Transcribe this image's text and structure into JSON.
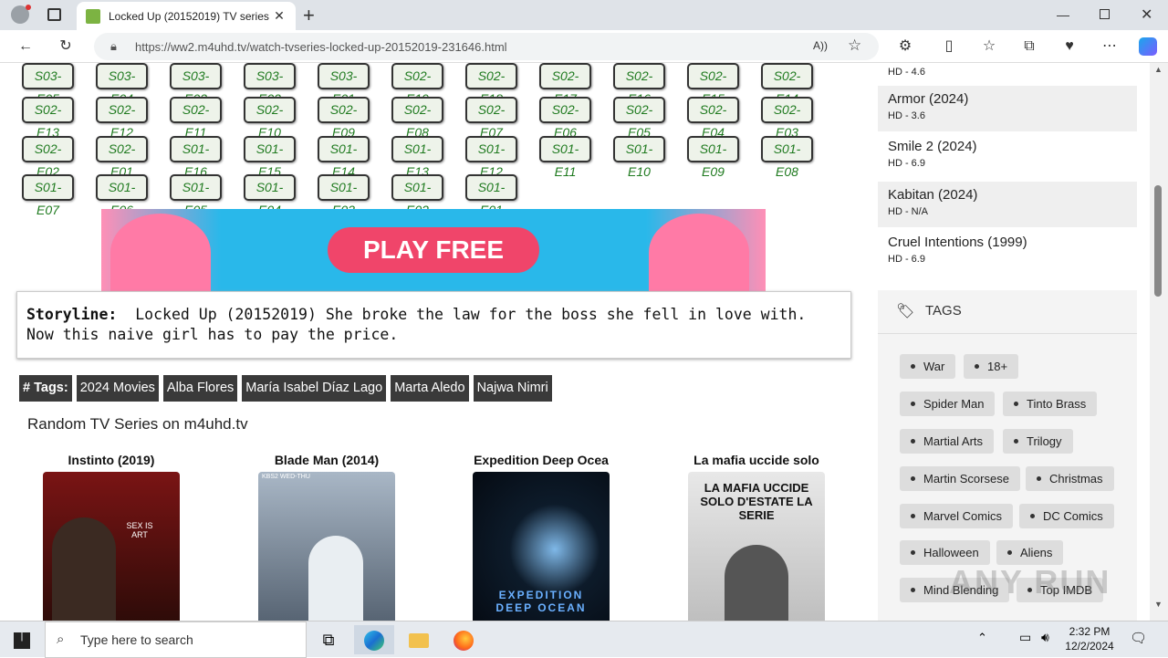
{
  "browser": {
    "tab_title": "Locked Up (20152019) TV series |",
    "url": "https://ww2.m4uhd.tv/watch-tvseries-locked-up-20152019-231646.html",
    "read_aloud": "A))"
  },
  "episodes": [
    [
      "S03-E05",
      "S03-E04",
      "S03-E03",
      "S03-E02",
      "S03-E01",
      "S02-E19",
      "S02-E18",
      "S02-E17",
      "S02-E16",
      "S02-E15",
      "S02-E14"
    ],
    [
      "S02-E13",
      "S02-E12",
      "S02-E11",
      "S02-E10",
      "S02-E09",
      "S02-E08",
      "S02-E07",
      "S02-E06",
      "S02-E05",
      "S02-E04",
      "S02-E03"
    ],
    [
      "S02-E02",
      "S02-E01",
      "S01-E16",
      "S01-E15",
      "S01-E14",
      "S01-E13",
      "S01-E12",
      "S01-E11",
      "S01-E10",
      "S01-E09",
      "S01-E08"
    ],
    [
      "S01-E07",
      "S01-E06",
      "S01-E05",
      "S01-E04",
      "S01-E03",
      "S01-E02",
      "S01-E01"
    ]
  ],
  "ad": {
    "button": "PLAY FREE"
  },
  "storyline": {
    "label": "Storyline:",
    "text": "Locked Up (20152019) She broke the law for the boss she fell in love with. Now this naive girl has to pay the price."
  },
  "tags": {
    "label": "# Tags:",
    "items": [
      "2024 Movies",
      "Alba Flores",
      "María Isabel Díaz Lago",
      "Marta Aledo",
      "Najwa Nimri"
    ]
  },
  "random": {
    "heading": "Random TV Series on m4uhd.tv",
    "items": [
      {
        "title": "Instinto (2019)",
        "poster_text": "SEX IS ART"
      },
      {
        "title": "Blade Man (2014)",
        "poster_text": "KBS2 WED-THU"
      },
      {
        "title": "Expedition Deep Ocea",
        "poster_text": "EXPEDITION DEEP OCEAN"
      },
      {
        "title": "La mafia uccide solo",
        "poster_text": "LA MAFIA UCCIDE SOLO D'ESTATE LA SERIE"
      }
    ]
  },
  "sidebar": {
    "top_partial": "HD - 4.6",
    "list": [
      {
        "title": "Armor (2024)",
        "sub": "HD - 3.6"
      },
      {
        "title": "Smile 2 (2024)",
        "sub": "HD - 6.9"
      },
      {
        "title": "Kabitan (2024)",
        "sub": "HD - N/A"
      },
      {
        "title": "Cruel Intentions (1999)",
        "sub": "HD - 6.9"
      }
    ],
    "tags_heading": "TAGS",
    "tag_pills": [
      "War",
      "18+",
      "Spider Man",
      "Tinto Brass",
      "Martial Arts",
      "Trilogy",
      "Martin Scorsese",
      "Christmas",
      "Marvel Comics",
      "DC Comics",
      "Halloween",
      "Aliens",
      "Mind Blending",
      "Top IMDB"
    ]
  },
  "taskbar": {
    "search_placeholder": "Type here to search",
    "time": "2:32 PM",
    "date": "12/2/2024"
  },
  "watermark": "ANY RUN"
}
